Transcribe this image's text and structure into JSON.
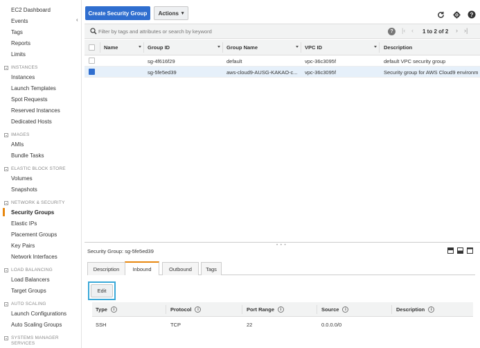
{
  "sidebar": {
    "collapse_icon": "chevron-left-icon",
    "items": [
      {
        "label": "EC2 Dashboard"
      },
      {
        "label": "Events"
      },
      {
        "label": "Tags"
      },
      {
        "label": "Reports"
      },
      {
        "label": "Limits"
      }
    ],
    "sections": [
      {
        "title": "INSTANCES",
        "items": [
          "Instances",
          "Launch Templates",
          "Spot Requests",
          "Reserved Instances",
          "Dedicated Hosts"
        ]
      },
      {
        "title": "IMAGES",
        "items": [
          "AMIs",
          "Bundle Tasks"
        ]
      },
      {
        "title": "ELASTIC BLOCK STORE",
        "items": [
          "Volumes",
          "Snapshots"
        ]
      },
      {
        "title": "NETWORK & SECURITY",
        "items": [
          "Security Groups",
          "Elastic IPs",
          "Placement Groups",
          "Key Pairs",
          "Network Interfaces"
        ]
      },
      {
        "title": "LOAD BALANCING",
        "items": [
          "Load Balancers",
          "Target Groups"
        ]
      },
      {
        "title": "AUTO SCALING",
        "items": [
          "Launch Configurations",
          "Auto Scaling Groups"
        ]
      },
      {
        "title": "SYSTEMS MANAGER SERVICES",
        "items": []
      }
    ],
    "active_item": "Security Groups"
  },
  "toolbar": {
    "create_label": "Create Security Group",
    "actions_label": "Actions",
    "refresh_icon": "refresh-icon",
    "settings_icon": "gear-icon",
    "help_icon": "help-icon"
  },
  "filter": {
    "placeholder": "Filter by tags and attributes or search by keyword",
    "pager_text": "1 to 2 of 2"
  },
  "table": {
    "columns": [
      "Name",
      "Group ID",
      "Group Name",
      "VPC ID",
      "Description"
    ],
    "rows": [
      {
        "name": "",
        "group_id": "sg-4f616f29",
        "group_name": "default",
        "vpc_id": "vpc-36c3095f",
        "description": "default VPC security group",
        "selected": false
      },
      {
        "name": "",
        "group_id": "sg-5fe5ed39",
        "group_name": "aws-cloud9-AUSG-KAKAO-c...",
        "vpc_id": "vpc-36c3095f",
        "description": "Security group for AWS Cloud9 environm",
        "selected": true
      }
    ]
  },
  "detail": {
    "title": "Security Group: sg-5fe5ed39",
    "tabs": [
      "Description",
      "Inbound",
      "Outbound",
      "Tags"
    ],
    "active_tab": "Inbound",
    "edit_label": "Edit",
    "inbound_columns": [
      "Type",
      "Protocol",
      "Port Range",
      "Source",
      "Description"
    ],
    "inbound_rows": [
      {
        "type": "SSH",
        "protocol": "TCP",
        "port_range": "22",
        "source": "0.0.0.0/0",
        "description": ""
      }
    ]
  },
  "colors": {
    "primary_button": "#2f6ecf",
    "active_accent": "#e8870e",
    "edit_highlight": "#39a8d8",
    "selected_row": "#e6f0fa"
  }
}
